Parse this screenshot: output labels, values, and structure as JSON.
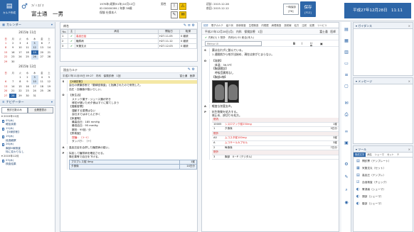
{
  "header": {
    "logo_label": "カルテ作成",
    "patient_kana": "ﾌｼﾞﾐ ｶｽﾞｵ",
    "patient_name": "富士通　一男",
    "birth": "1976年(昭和51年)10月12日",
    "sex": "男性",
    "id_line": "ID 00000099 / 年齢 38歳",
    "note_line": "",
    "insurance_line": "保険 社保本人",
    "visit_label": "初診:",
    "visit_date": "2015.12.28",
    "last_label": "前回:",
    "last_date": "2015.12.12",
    "temp_label": "一時保存",
    "temp_sub": "[F6]",
    "save_label": "保存",
    "save_sub": "[F12]",
    "clock": "平成27年12月28日　11:11"
  },
  "sidebar": {
    "calendar_title": "カレンダー",
    "month1": "2015年 11月",
    "month2": "2015年 12月",
    "weekdays": [
      "日",
      "月",
      "火",
      "水",
      "木",
      "金",
      "土"
    ],
    "navigator_title": "ナビゲーター",
    "tab1": "受診日数のみ",
    "tab2": "全履歴表示",
    "groups": [
      {
        "label": "▾ 2015年11月",
        "items": [
          "05(木)",
          "軽症疾患",
          "12(木)",
          "【X線診断】",
          "19(木)",
          "経過観察",
          "26(木)",
          "胸部X線検査",
          "特に変わりなし"
        ]
      },
      {
        "label": "▾ 2015年12月",
        "items": [
          "03(木)",
          "検査結果",
          "10(木)",
          "経過観察"
        ]
      }
    ]
  },
  "diagnosis": {
    "title": "病名",
    "headers": [
      "No.",
      "主",
      "病名",
      "開始日",
      "転帰"
    ],
    "rows": [
      {
        "no": "1",
        "check": "✔",
        "name": "高血圧症",
        "start": "H27.11.05",
        "outcome": "0 継続"
      },
      {
        "no": "2",
        "check": "✔",
        "name": "糖尿病",
        "start": "H27.11.12",
        "outcome": "0 継続"
      },
      {
        "no": "3",
        "check": "✔",
        "name": "気管支炎",
        "start": "H27.12.03",
        "outcome": "0 継続"
      }
    ]
  },
  "past": {
    "title": "過去カルテ",
    "header": "平成27年11月05日 09:27　内科　保険診療　1回",
    "doctor": "富士通　医師",
    "lines_s": [
      "【X線診断】",
      "会社の健康診断で「要精密検査」と指摘されたので来院した。",
      "血圧・血糖値が高いらしい。"
    ],
    "lines_o": [
      "【食生活】",
      "スナック菓子・ジュース類が好き",
      "帰宅が遅いため夕食はすぐに寝てしまう",
      "【運動習慣】",
      "運動する習慣はない",
      "会社まではほとんど歩く",
      "【体重等】",
      "最高血圧：185 mmHg",
      "最低血圧：95 mmHg",
      "脈拍：95回／分",
      "【尿検査】",
      "尿糖：（＋＋）",
      "タンパク：（＋）"
    ],
    "lines_a": [
      "高血圧症を合併した糖尿病の疑い。"
    ],
    "lines_p": [
      "採血して糖尿病を確定させる。",
      "降圧薬等で血圧を下げる。"
    ],
    "orders": [
      "プロプレス錠 4mg",
      "夕食後"
    ],
    "order_counts": [
      "1錠",
      "14日分"
    ]
  },
  "editor": {
    "tabs": [
      "初診",
      "電子カルテ",
      "紹介状",
      "検体検査",
      "生理検査",
      "内視鏡",
      "病理検査",
      "放射線",
      "処方",
      "注射",
      "処置",
      "リハビリ"
    ],
    "title": "平成27年12月28日(月)　内科　保険診療　1回",
    "dept": "内科",
    "doctor": "富士通　医師",
    "sub": "内科(1) 1 院外　内科(4) 01 総合(本人)",
    "font_select": "Meiryo UI",
    "lines_s": [
      "薬は忘れずに飲んでいる。",
      "1 週間前から咳が出始め、現在は痰がとまらない。"
    ],
    "lines_o": [
      "【発熱】",
      "体温：39.5℃",
      "【胸部聴診】",
      "呼吸音異常なし",
      "【胸部X線】"
    ],
    "lines_a": [
      "軽度な気管支炎。"
    ],
    "lines_p": [
      "抗生物質を処方する。",
      "咳止め、痰切りを処方。"
    ],
    "rx": [
      {
        "section": "院内",
        "a": "",
        "b": "",
        "c": ""
      },
      {
        "section": "",
        "a": "10005",
        "b": "シスロマック錠250mg",
        "c": "1錠"
      },
      {
        "section": "",
        "a": "1",
        "b": "夕食後",
        "c": "3日分"
      },
      {
        "section": "院外",
        "a": "",
        "b": "",
        "c": ""
      },
      {
        "section": "",
        "a": "A0",
        "b": "ムコスタ錠100mg",
        "c": "3錠"
      },
      {
        "section": "",
        "a": "A",
        "b": "ムコサールカプセル",
        "c": "3錠"
      },
      {
        "section": "",
        "a": "2",
        "b": "毎食後",
        "c": "7日分"
      },
      {
        "section": "院外",
        "a": "",
        "b": "",
        "c": ""
      },
      {
        "section": "",
        "a": "3",
        "b": "胸部　X－P（デジタル）",
        "c": ""
      }
    ]
  },
  "right": {
    "guidance_title": "ガイダンス",
    "message_title": "メッセージ",
    "tool_title": "ツール",
    "tool_tabs": [
      "既成文字",
      "病名",
      "シェーマ",
      "セット",
      "テ"
    ],
    "tools": [
      "問診票（テンプレート）",
      "気管支炎（セット）",
      "高血圧（テンプレ）",
      "血液検査（チェック）",
      "胃潰瘍（シェーマ）",
      "頭部（シェーマ）",
      "腹部（シェーマ）"
    ]
  }
}
